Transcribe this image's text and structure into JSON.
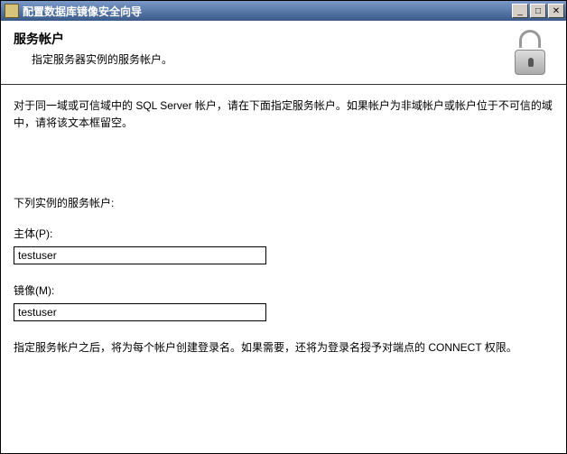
{
  "window": {
    "title": "配置数据库镜像安全向导"
  },
  "header": {
    "title": "服务帐户",
    "subtitle": "指定服务器实例的服务帐户。"
  },
  "content": {
    "instructions": "对于同一域或可信域中的 SQL Server 帐户，请在下面指定服务帐户。如果帐户为非域帐户或帐户位于不可信的域中，请将该文本框留空。",
    "section_label": "下列实例的服务帐户:",
    "principal": {
      "label": "主体(P):",
      "value": "testuser"
    },
    "mirror": {
      "label": "镜像(M):",
      "value": "testuser"
    },
    "footnote": "指定服务帐户之后，将为每个帐户创建登录名。如果需要，还将为登录名授予对端点的 CONNECT 权限。"
  },
  "winbtns": {
    "min": "_",
    "max": "□",
    "close": "✕"
  }
}
